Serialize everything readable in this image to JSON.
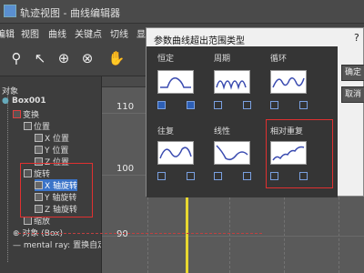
{
  "window": {
    "title": "轨迹视图 - 曲线编辑器"
  },
  "menu": [
    "编辑",
    "视图",
    "曲线",
    "关键点",
    "切线",
    "显示"
  ],
  "tree": {
    "items": [
      "对象",
      "Box001",
      "变换",
      "位置",
      "X 位置",
      "Y 位置",
      "Z 位置",
      "旋转",
      "X 轴旋转",
      "Y 轴旋转",
      "Z 轴旋转",
      "缩放",
      "对象 (Box)",
      "mental ray: 置换自定义"
    ]
  },
  "graph": {
    "labels": [
      "110",
      "100",
      "90"
    ]
  },
  "dialog": {
    "title": "参数曲线超出范围类型",
    "help": "?",
    "buttons": [
      "确定",
      "取消"
    ],
    "options": [
      {
        "label": "恒定"
      },
      {
        "label": "周期"
      },
      {
        "label": "循环"
      },
      {
        "label": "往复"
      },
      {
        "label": "线性"
      },
      {
        "label": "相对重复"
      }
    ]
  },
  "colors": {
    "accent": "#3a73c8",
    "highlight_box": "#e03030",
    "keyframe_line": "#e8d830"
  }
}
